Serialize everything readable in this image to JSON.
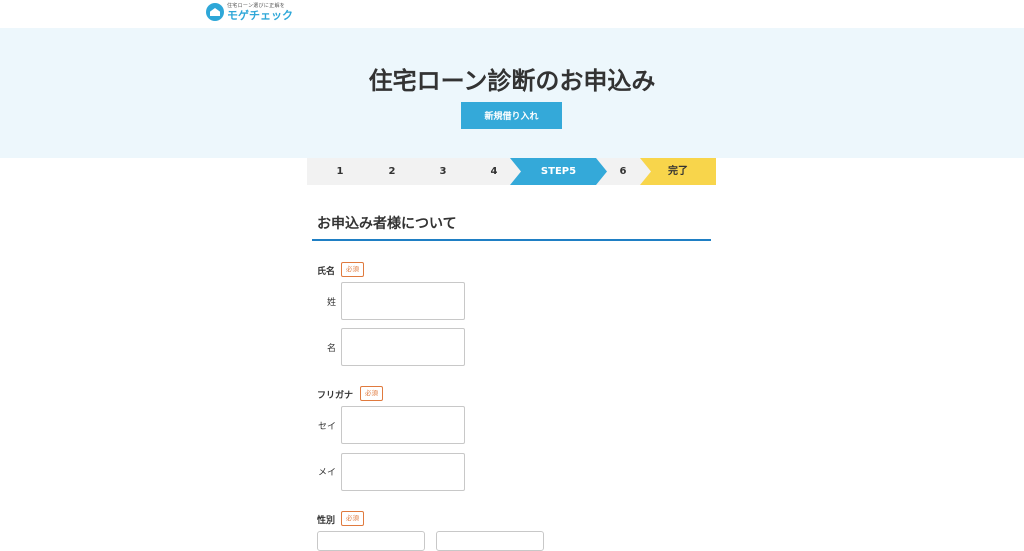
{
  "logo": {
    "tagline": "住宅ローン選びに正解を",
    "name": "モゲチェック",
    "icon": "house-icon"
  },
  "hero": {
    "title": "住宅ローン診断のお申込み",
    "button_label": "新規借り入れ"
  },
  "steps": {
    "items": [
      "1",
      "2",
      "3",
      "4",
      "STEP5",
      "6",
      "完了"
    ],
    "active": "STEP5"
  },
  "section": {
    "title": "お申込み者様について"
  },
  "form": {
    "required_label": "必須",
    "name": {
      "label": "氏名",
      "last_label": "姓",
      "first_label": "名"
    },
    "kana": {
      "label": "フリガナ",
      "last_label": "セイ",
      "first_label": "メイ"
    },
    "gender": {
      "label": "性別"
    }
  },
  "colors": {
    "accent": "#34a9d9",
    "hero_bg": "#edf7fc",
    "required": "#e07a3e",
    "done": "#f8d54b",
    "rule": "#1f7fc4"
  }
}
